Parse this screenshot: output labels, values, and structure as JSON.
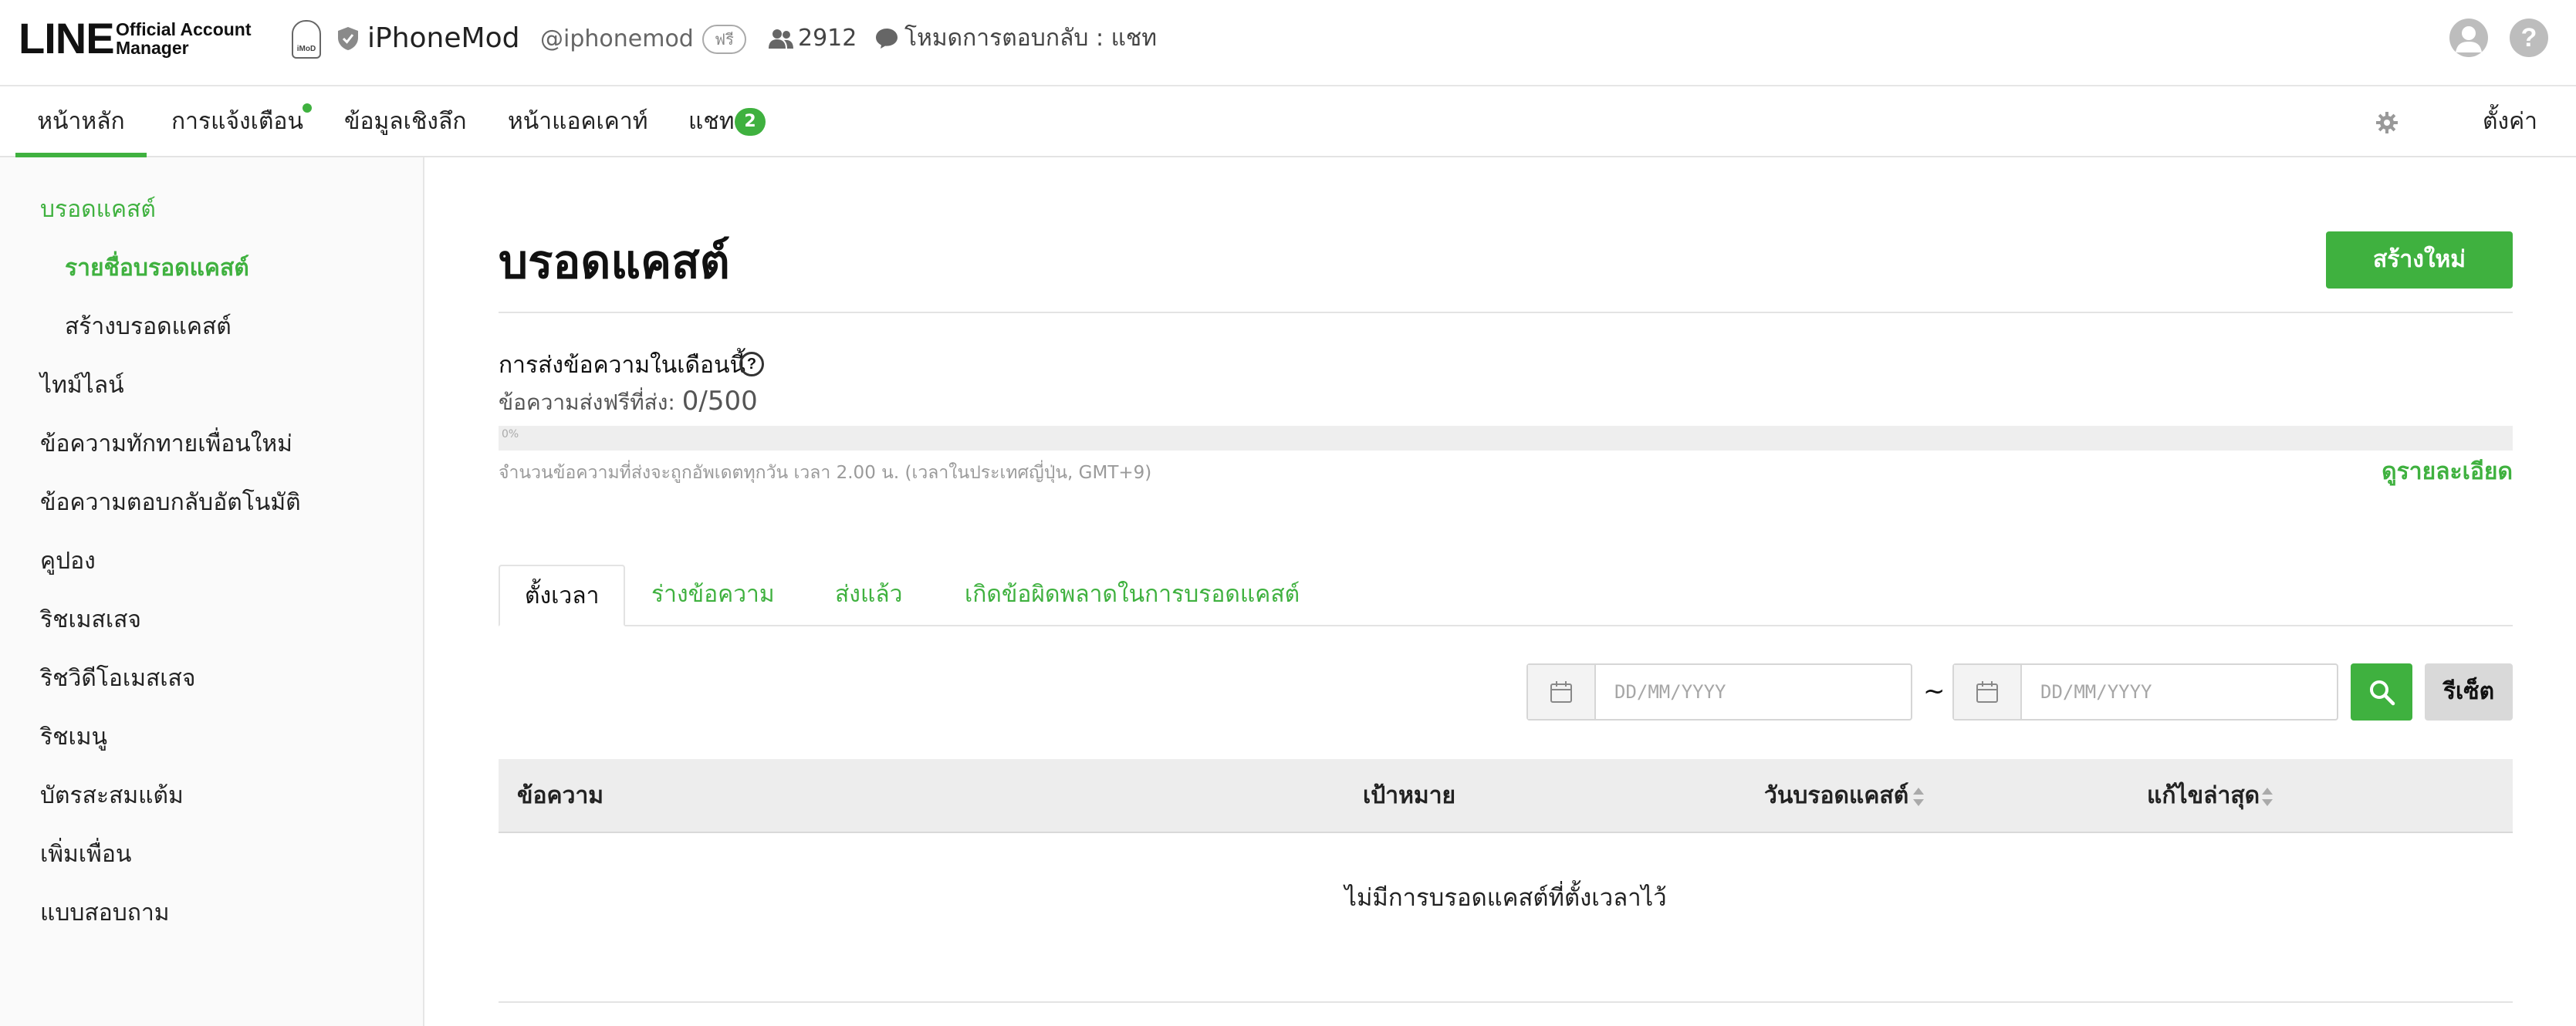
{
  "header": {
    "logo_main": "LINE",
    "logo_sub": "Official Account Manager",
    "avatar_text": "iMoD",
    "account_name": "iPhoneMod",
    "account_id": "@iphonemod",
    "plan_badge": "ฟรี",
    "friends_count": "2912",
    "reply_mode": "โหมดการตอบกลับ : แชท"
  },
  "nav": {
    "tabs": [
      {
        "label": "หน้าหลัก"
      },
      {
        "label": "การแจ้งเตือน"
      },
      {
        "label": "ข้อมูลเชิงลึก"
      },
      {
        "label": "หน้าแอคเคาท์"
      },
      {
        "label": "แชท"
      }
    ],
    "chat_badge": "2",
    "settings_label": "ตั้งค่า"
  },
  "sidebar": {
    "items": [
      {
        "label": "บรอดแคสต์"
      },
      {
        "label": "รายชื่อบรอดแคสต์"
      },
      {
        "label": "สร้างบรอดแคสต์"
      },
      {
        "label": "ไทม์ไลน์"
      },
      {
        "label": "ข้อความทักทายเพื่อนใหม่"
      },
      {
        "label": "ข้อความตอบกลับอัตโนมัติ"
      },
      {
        "label": "คูปอง"
      },
      {
        "label": "ริชเมสเสจ"
      },
      {
        "label": "ริชวิดีโอเมสเสจ"
      },
      {
        "label": "ริชเมนู"
      },
      {
        "label": "บัตรสะสมแต้ม"
      },
      {
        "label": "เพิ่มเพื่อน"
      },
      {
        "label": "แบบสอบถาม"
      }
    ]
  },
  "main": {
    "title": "บรอดแคสต์",
    "create_button": "สร้างใหม่",
    "quota": {
      "label": "การส่งข้อความในเดือนนี้",
      "free_label": "ข้อความส่งฟรีที่ส่ง:",
      "free_value": "0/500",
      "progress_percent": 0,
      "progress_text": "0%",
      "update_note": "จำนวนข้อความที่ส่งจะถูกอัพเดตทุกวัน เวลา 2.00 น. (เวลาในประเทศญี่ปุ่น, GMT+9)",
      "details_link": "ดูรายละเอียด"
    },
    "subtabs": [
      {
        "label": "ตั้งเวลา"
      },
      {
        "label": "ร่างข้อความ"
      },
      {
        "label": "ส่งแล้ว"
      },
      {
        "label": "เกิดข้อผิดพลาดในการบรอดแคสต์"
      }
    ],
    "filter": {
      "start_placeholder": "DD/MM/YYYY",
      "end_placeholder": "DD/MM/YYYY",
      "separator": "~",
      "reset_label": "รีเซ็ต"
    },
    "table": {
      "columns": [
        {
          "label": "ข้อความ"
        },
        {
          "label": "เป้าหมาย"
        },
        {
          "label": "วันบรอดแคสต์"
        },
        {
          "label": "แก้ไขล่าสุด"
        }
      ],
      "empty_message": "ไม่มีการบรอดแคสต์ที่ตั้งเวลาไว้"
    }
  },
  "colors": {
    "accent": "#3fb13f",
    "header_border": "#e6e6e6",
    "sidebar_bg": "#fafafa",
    "table_head_bg": "#ededed"
  },
  "icons": {
    "shield": "shield-icon",
    "people": "people-icon",
    "chat": "chat-icon",
    "user": "user-icon",
    "help": "help-icon",
    "gear": "gear-icon",
    "calendar": "calendar-icon",
    "search": "search-icon",
    "sort": "sort-icon"
  }
}
